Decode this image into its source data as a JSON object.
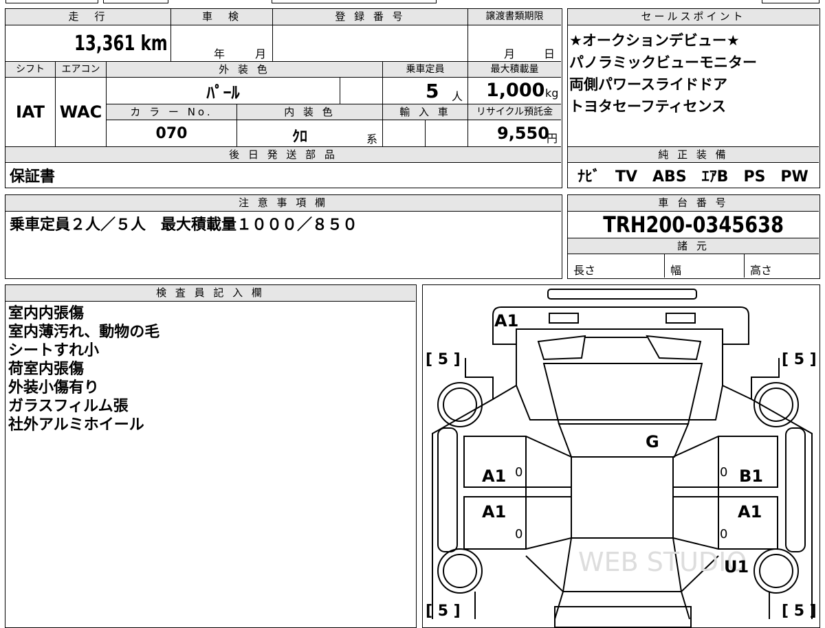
{
  "top_fragments": [
    "",
    ""
  ],
  "mileage": {
    "label": "走　行",
    "value": "13,361 km"
  },
  "inspection": {
    "label": "車　検",
    "year_unit": "年",
    "month_unit": "月"
  },
  "registration": {
    "label": "登 録 番 号",
    "value": ""
  },
  "transfer_deadline": {
    "label": "譲渡書類期限",
    "month_unit": "月",
    "day_unit": "日"
  },
  "shift": {
    "label": "シフト",
    "value": "IAT"
  },
  "aircon": {
    "label": "エアコン",
    "value": "WAC"
  },
  "exterior_color": {
    "label": "外 装 色",
    "value": "ﾊﾟｰﾙ"
  },
  "capacity": {
    "label": "乗車定員",
    "value": "5",
    "unit": "人"
  },
  "max_load": {
    "label": "最大積載量",
    "value": "1,000",
    "unit": "kg"
  },
  "color_no": {
    "label": "カ ラ ー No.",
    "value": "070"
  },
  "interior_color": {
    "label": "内 装 色",
    "value": "ｸﾛ",
    "suffix": "系"
  },
  "import": {
    "label": "輸 入 車"
  },
  "recycle": {
    "label": "リサイクル預託金",
    "value": "9,550",
    "unit": "円"
  },
  "later_parts": {
    "label": "後 日 発 送 部 品",
    "value": "保証書"
  },
  "sales_points": {
    "label": "セールスポイント",
    "items": [
      "★オークションデビュー★",
      "パノラミックビューモニター",
      "両側パワースライドドア",
      "トヨタセーフティセンス"
    ]
  },
  "equipment": {
    "label": "純 正 装 備",
    "value": "ﾅﾋﾞ　TV　ABS　ｴｱB　PS　PW"
  },
  "notes": {
    "label": "注 意 事 項 欄",
    "value": "乗車定員２人／５人　最大積載量１０００／８５０"
  },
  "chassis": {
    "label": "車 台 番 号",
    "value": "TRH200-0345638"
  },
  "specs": {
    "label": "諸 元",
    "length": "長さ",
    "width": "幅",
    "height": "高さ"
  },
  "inspector": {
    "label": "検 査 員 記 入 欄",
    "lines": [
      "室内内張傷",
      "室内薄汚れ、動物の毛",
      "シートすれ小",
      "荷室内張傷",
      "外装小傷有り",
      "ガラスフィルム張",
      "社外アルミホイール"
    ]
  },
  "diagram": {
    "tires": [
      "[ 5 ]",
      "[ 5 ]",
      "[ 5 ]",
      "[ 5 ]"
    ],
    "marks": [
      "A1",
      "G",
      "A1",
      "B1",
      "A1",
      "A1",
      "U1"
    ],
    "zeros": [
      "0",
      "0",
      "0",
      "0"
    ],
    "watermark": "WEB STUDIO"
  }
}
